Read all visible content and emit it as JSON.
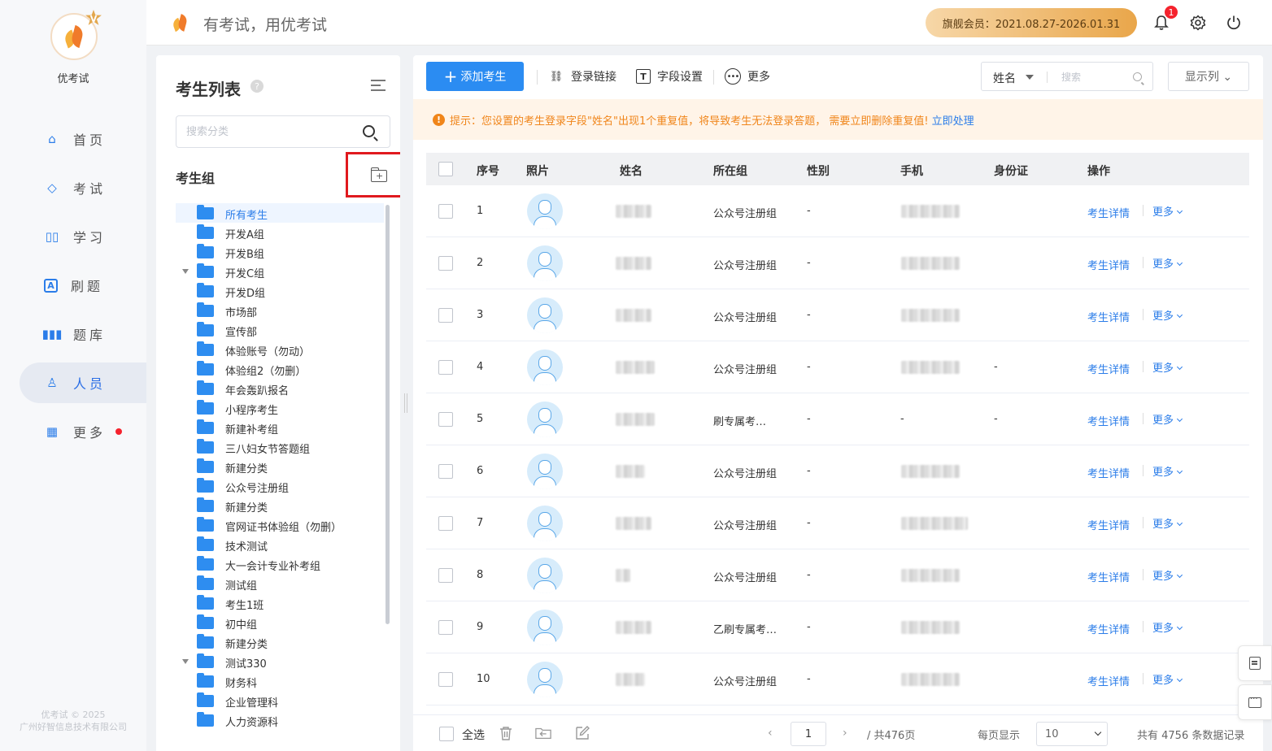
{
  "app": {
    "name": "优考试",
    "slogan": "有考试，用优考试",
    "vip_badge": "V",
    "copyright": [
      "优考试 © 2025",
      "广州好智信息技术有限公司"
    ]
  },
  "header": {
    "membership": "旗舰会员：2021.08.27-2026.01.31",
    "notifications_count": "1",
    "icons": [
      "bell-icon",
      "gear-icon",
      "power-icon"
    ]
  },
  "nav": {
    "items": [
      {
        "label": "首页",
        "icon": "home-icon",
        "glyph": "⌂"
      },
      {
        "label": "考试",
        "icon": "eraser-icon",
        "glyph": "◇"
      },
      {
        "label": "学习",
        "icon": "book-icon",
        "glyph": "▯▯"
      },
      {
        "label": "刷题",
        "icon": "a-box-icon",
        "glyph": "A"
      },
      {
        "label": "题库",
        "icon": "bars-icon",
        "glyph": "▮▮▮"
      },
      {
        "label": "人员",
        "icon": "user-icon",
        "glyph": "♙",
        "active": true
      },
      {
        "label": "更多",
        "icon": "apps-icon",
        "glyph": "▦",
        "dot": true
      }
    ]
  },
  "groups": {
    "title": "考生列表",
    "help": "?",
    "search_placeholder": "搜索分类",
    "section_label": "考生组",
    "add_plus": "+",
    "items": [
      {
        "label": "所有考生",
        "active": true
      },
      {
        "label": "开发A组"
      },
      {
        "label": "开发B组"
      },
      {
        "label": "开发C组",
        "caret": true
      },
      {
        "label": "开发D组"
      },
      {
        "label": "市场部"
      },
      {
        "label": "宣传部"
      },
      {
        "label": "体验账号（勿动）"
      },
      {
        "label": "体验组2（勿删）"
      },
      {
        "label": "年会轰趴报名"
      },
      {
        "label": "小程序考生"
      },
      {
        "label": "新建补考组"
      },
      {
        "label": "三八妇女节答题组"
      },
      {
        "label": "新建分类"
      },
      {
        "label": "公众号注册组"
      },
      {
        "label": "新建分类"
      },
      {
        "label": "官网证书体验组（勿删）"
      },
      {
        "label": "技术测试"
      },
      {
        "label": "大一会计专业补考组"
      },
      {
        "label": "测试组"
      },
      {
        "label": "考生1班"
      },
      {
        "label": "初中组"
      },
      {
        "label": "新建分类"
      },
      {
        "label": "测试330",
        "caret": true
      },
      {
        "label": "财务科"
      },
      {
        "label": "企业管理科"
      },
      {
        "label": "人力资源科"
      }
    ]
  },
  "toolbar": {
    "add_icon": "+",
    "add_label": "添加考生",
    "login_link": "登录链接",
    "login_link_icon": "⛓",
    "field_settings": "字段设置",
    "field_icon": "T",
    "more": "更多",
    "more_icon": "•••",
    "filter_field": "姓名",
    "search_placeholder": "搜索",
    "columns_label": "显示列 ⌄"
  },
  "tip": {
    "icon": "!",
    "text": "提示：您设置的考生登录字段\"姓名\"出现1个重复值，将导致考生无法登录答题， 需要立即删除重复值!",
    "action": "立即处理"
  },
  "table": {
    "headers": {
      "index": "序号",
      "photo": "照片",
      "name": "姓名",
      "group": "所在组",
      "gender": "性别",
      "phone": "手机",
      "idcard": "身份证",
      "actions": "操作"
    },
    "rows": [
      {
        "index": "1",
        "group": "公众号注册组",
        "gender": "-",
        "phone": "",
        "idcard": "",
        "detail": "考生详情",
        "more": "更多"
      },
      {
        "index": "2",
        "group": "公众号注册组",
        "gender": "-",
        "phone": "",
        "idcard": "",
        "detail": "考生详情",
        "more": "更多"
      },
      {
        "index": "3",
        "group": "公众号注册组",
        "gender": "-",
        "phone": "",
        "idcard": "",
        "detail": "考生详情",
        "more": "更多"
      },
      {
        "index": "4",
        "group": "公众号注册组",
        "gender": "-",
        "phone": "",
        "idcard": "-",
        "detail": "考生详情",
        "more": "更多"
      },
      {
        "index": "5",
        "group": "刷专属考…",
        "gender": "-",
        "phone": "-",
        "idcard": "-",
        "detail": "考生详情",
        "more": "更多"
      },
      {
        "index": "6",
        "group": "公众号注册组",
        "gender": "-",
        "phone": "",
        "idcard": "",
        "detail": "考生详情",
        "more": "更多"
      },
      {
        "index": "7",
        "group": "公众号注册组",
        "gender": "-",
        "phone": "",
        "idcard": "",
        "detail": "考生详情",
        "more": "更多"
      },
      {
        "index": "8",
        "group": "公众号注册组",
        "gender": "-",
        "phone": "",
        "idcard": "",
        "detail": "考生详情",
        "more": "更多"
      },
      {
        "index": "9",
        "group": "乙刷专属考…",
        "gender": "-",
        "phone": "",
        "idcard": "",
        "detail": "考生详情",
        "more": "更多"
      },
      {
        "index": "10",
        "group": "公众号注册组",
        "gender": "-",
        "phone": "",
        "idcard": "",
        "detail": "考生详情",
        "more": "更多"
      }
    ]
  },
  "footer": {
    "select_all": "全选",
    "icons": [
      "trash-icon",
      "move-folder-icon",
      "edit-icon"
    ],
    "prev": "‹",
    "page": "1",
    "next": "›",
    "total_pages": "/ 共476页",
    "per_page_label": "每页显示",
    "per_page": "10",
    "total_records": "共有 4756 条数据记录"
  }
}
